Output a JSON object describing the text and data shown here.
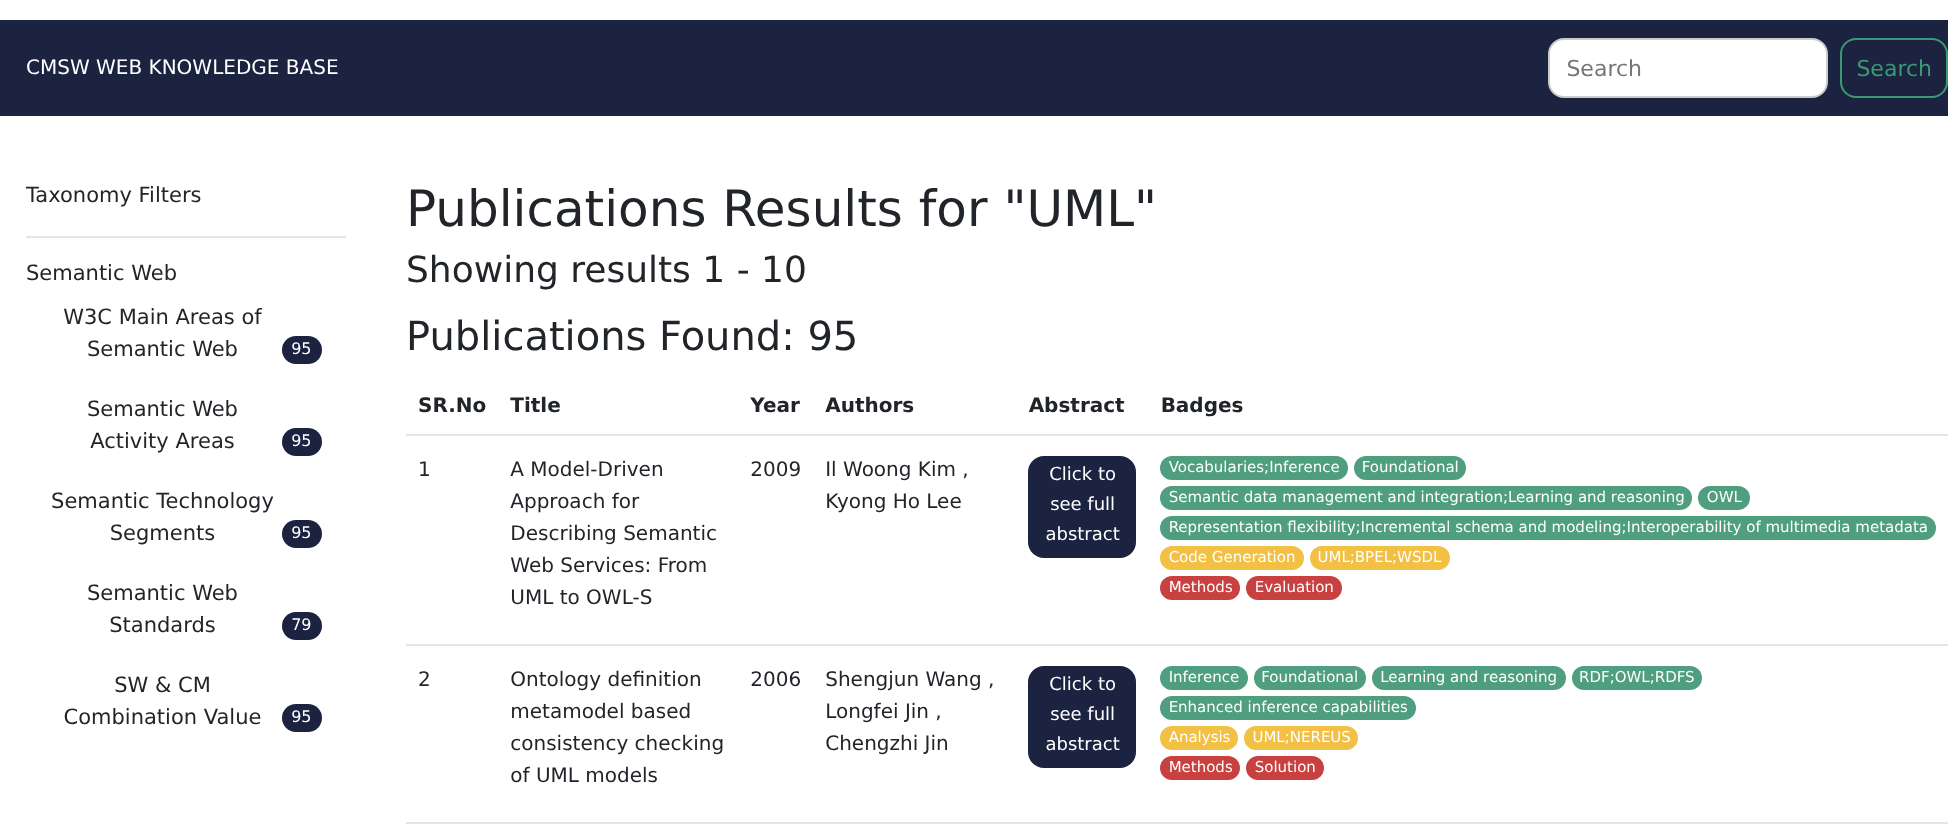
{
  "navbar": {
    "brand": "CMSW WEB KNOWLEDGE BASE",
    "search": {
      "placeholder": "Search"
    },
    "search_button": "Search"
  },
  "sidebar": {
    "title": "Taxonomy Filters",
    "section": "Semantic Web",
    "items": [
      {
        "label": "W3C Main Areas of Semantic Web",
        "count": "95"
      },
      {
        "label": "Semantic Web Activity Areas",
        "count": "95"
      },
      {
        "label": "Semantic Technology Segments",
        "count": "95"
      },
      {
        "label": "Semantic Web Standards",
        "count": "79"
      },
      {
        "label": "SW & CM Combination Value",
        "count": "95"
      }
    ]
  },
  "main": {
    "heading": "Publications Results for \"UML\"",
    "showing": "Showing results 1 - 10",
    "found": "Publications Found: 95"
  },
  "table": {
    "columns": [
      "SR.No",
      "Title",
      "Year",
      "Authors",
      "Abstract",
      "Badges"
    ],
    "rows": [
      {
        "sr": "1",
        "title": "A Model-Driven Approach for Describing Semantic Web Services: From UML to OWL-S",
        "year": "2009",
        "authors": [
          "Il Woong Kim ,",
          "Kyong Ho Lee"
        ],
        "abstract_button": "Click to see full abstract",
        "badge_groups": [
          {
            "color": "#4e9e7f",
            "badges": [
              "Vocabularies;Inference",
              "Foundational"
            ]
          },
          {
            "color": "#4e9e7f",
            "badges": [
              "Semantic data management and integration;Learning and reasoning",
              "OWL"
            ]
          },
          {
            "color": "#4e9e7f",
            "badges": [
              "Representation flexibility;Incremental schema and modeling;Interoperability of multimedia metadata"
            ]
          },
          {
            "color": "#f2c044",
            "badges": [
              "Code Generation",
              "UML;BPEL;WSDL"
            ]
          },
          {
            "color": "#c8403f",
            "badges": [
              "Methods",
              "Evaluation"
            ]
          }
        ]
      },
      {
        "sr": "2",
        "title": "Ontology definition metamodel based consistency checking of UML models",
        "year": "2006",
        "authors": [
          "Shengjun Wang ,",
          "Longfei Jin ,",
          "Chengzhi Jin"
        ],
        "abstract_button": "Click to see full abstract",
        "badge_groups": [
          {
            "color": "#4e9e7f",
            "badges": [
              "Inference",
              "Foundational",
              "Learning and reasoning",
              "RDF;OWL;RDFS"
            ]
          },
          {
            "color": "#4e9e7f",
            "badges": [
              "Enhanced inference capabilities"
            ]
          },
          {
            "color": "#f2c044",
            "badges": [
              "Analysis",
              "UML;NEREUS"
            ]
          },
          {
            "color": "#c8403f",
            "badges": [
              "Methods",
              "Solution"
            ]
          }
        ]
      }
    ]
  }
}
